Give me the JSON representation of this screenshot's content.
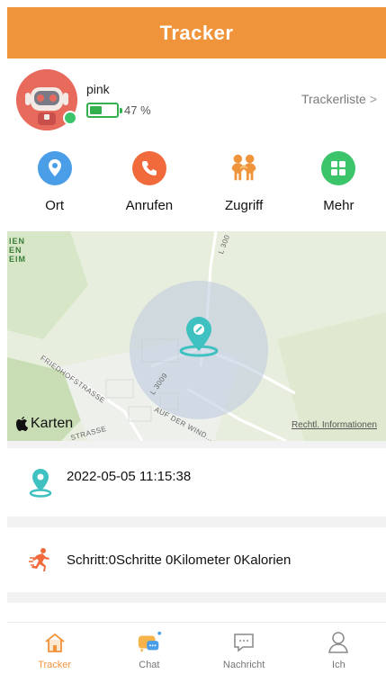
{
  "header": {
    "title": "Tracker"
  },
  "device": {
    "name": "pink",
    "battery_percent": 47,
    "battery_text": "47 %",
    "online": true,
    "tracker_list_label": "Trackerliste",
    "tracker_list_chevron": ">"
  },
  "actions": [
    {
      "label": "Ort",
      "icon": "location-pin-icon",
      "color": "#4a9ee8"
    },
    {
      "label": "Anrufen",
      "icon": "phone-icon",
      "color": "#f06a3c"
    },
    {
      "label": "Zugriff",
      "icon": "family-icon",
      "color": "#f0943c"
    },
    {
      "label": "Mehr",
      "icon": "grid-icon",
      "color": "#3cc46a"
    }
  ],
  "map": {
    "brand": "Karten",
    "legal_link": "Rechtl. Informationen",
    "place_label": "IEN\nEN\nEIM",
    "roads": {
      "top_right": "L 300",
      "friedhof": "FRIEDHOFSTRASSE",
      "l3009": "L 3009",
      "auf_der": "AUF DER WIND...",
      "strasse": "STRASSE"
    }
  },
  "last_location": {
    "timestamp": "2022-05-05 11:15:38",
    "icon": "location-pin-icon"
  },
  "activity": {
    "text": "Schritt:0Schritte 0Kilometer 0Kalorien",
    "icon": "running-icon"
  },
  "tabs": [
    {
      "label": "Tracker",
      "icon": "home-icon",
      "active": true
    },
    {
      "label": "Chat",
      "icon": "chat-icon",
      "active": false
    },
    {
      "label": "Nachricht",
      "icon": "message-icon",
      "active": false
    },
    {
      "label": "Ich",
      "icon": "person-icon",
      "active": false
    }
  ],
  "colors": {
    "accent": "#f0943c",
    "online": "#3cc46a",
    "battery": "#35b04f",
    "pin": "#3ec1c0"
  }
}
